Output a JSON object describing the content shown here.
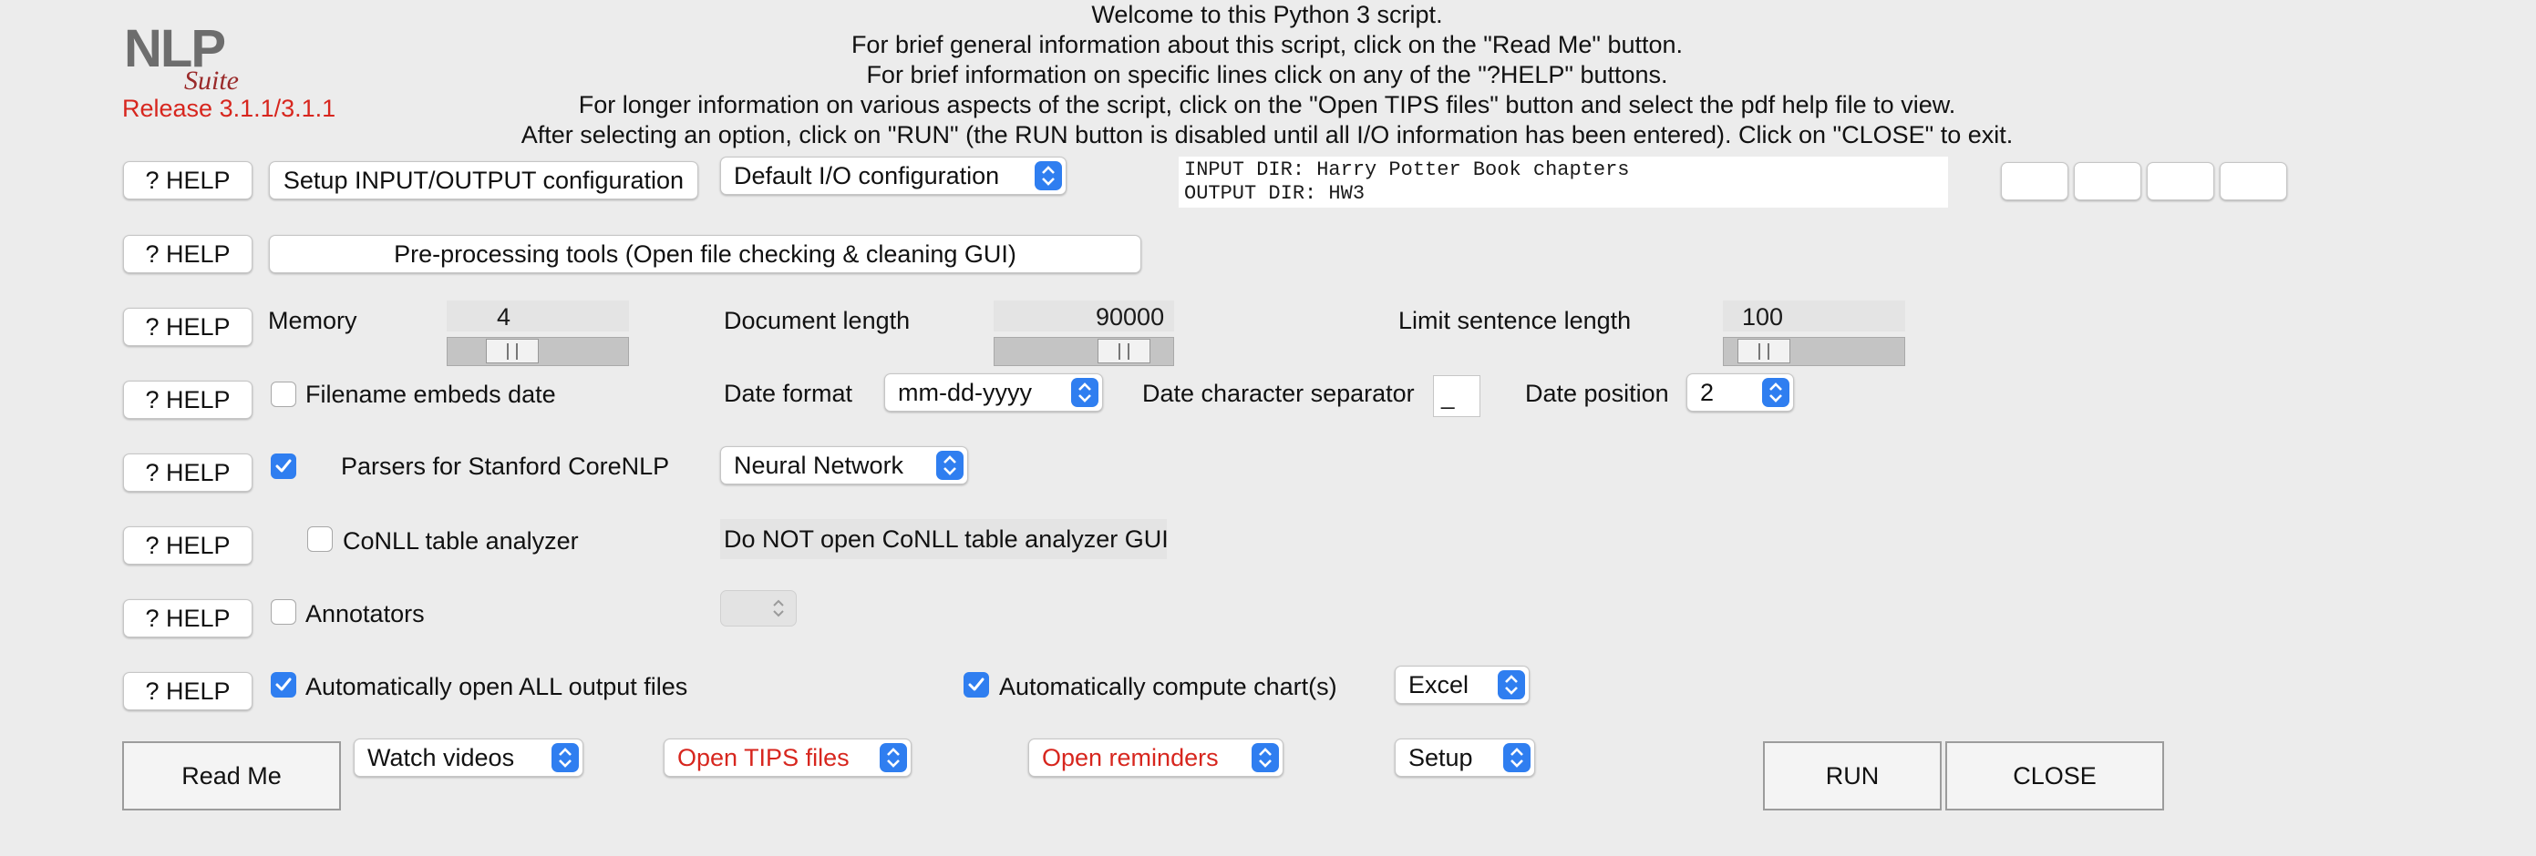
{
  "logo": {
    "main": "NLP",
    "sub": "Suite"
  },
  "release": "Release 3.1.1/3.1.1",
  "intro": [
    "Welcome to this Python 3 script.",
    "For brief general information about this script, click on the \"Read Me\" button.",
    "For brief information on specific lines click on any of the \"?HELP\" buttons.",
    "For longer information on various aspects of the script, click on the \"Open TIPS files\" button and select the pdf help file to view.",
    "After selecting an option, click on \"RUN\" (the RUN button is disabled until all I/O information has been entered).   Click on \"CLOSE\" to exit."
  ],
  "help_label": "? HELP",
  "io": {
    "setup_button": "Setup INPUT/OUTPUT configuration",
    "config_select": "Default I/O configuration",
    "input_dir": "INPUT DIR: Harry Potter Book chapters",
    "output_dir": "OUTPUT DIR: HW3"
  },
  "preprocessing_button": "Pre-processing tools (Open file checking & cleaning GUI)",
  "memory": {
    "label": "Memory",
    "value": "4",
    "fraction": 0.3
  },
  "doc_length": {
    "label": "Document length",
    "value": "90000",
    "fraction": 0.82
  },
  "sentence_length": {
    "label": "Limit sentence length",
    "value": "100",
    "fraction": 0.1
  },
  "date": {
    "filename_embeds_label": "Filename embeds date",
    "filename_embeds_checked": false,
    "format_label": "Date format",
    "format_value": "mm-dd-yyyy",
    "separator_label": "Date character separator",
    "separator_value": "_",
    "position_label": "Date position",
    "position_value": "2"
  },
  "parsers": {
    "label": "Parsers for Stanford CoreNLP",
    "checked": true,
    "value": "Neural Network"
  },
  "conll": {
    "label": "CoNLL table analyzer",
    "checked": false,
    "status": "Do NOT open CoNLL table analyzer GUI"
  },
  "annotators": {
    "label": "Annotators",
    "checked": false
  },
  "output": {
    "open_all_label": "Automatically open ALL output files",
    "open_all_checked": true,
    "compute_charts_label": "Automatically compute chart(s)",
    "compute_charts_checked": true,
    "chart_package": "Excel"
  },
  "bottom": {
    "read_me": "Read Me",
    "watch_videos": "Watch videos",
    "open_tips": "Open TIPS files",
    "open_reminders": "Open reminders",
    "setup": "Setup",
    "run": "RUN",
    "close": "CLOSE"
  },
  "colors": {
    "accent": "#2f7ef0",
    "warning_text": "#d7261e"
  }
}
